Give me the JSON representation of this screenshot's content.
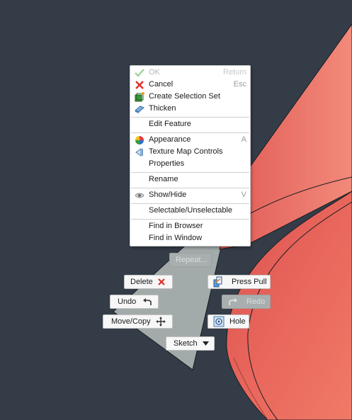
{
  "context_menu": {
    "items": [
      {
        "label": "OK",
        "shortcut": "Return",
        "icon": "checkmark-icon",
        "disabled": true
      },
      {
        "label": "Cancel",
        "shortcut": "Esc",
        "icon": "red-x-icon"
      },
      {
        "label": "Create Selection Set",
        "shortcut": "",
        "icon": "selection-set-icon"
      },
      {
        "label": "Thicken",
        "shortcut": "",
        "icon": "thicken-icon"
      },
      {
        "label": "Edit Feature",
        "shortcut": ""
      },
      {
        "label": "Appearance",
        "shortcut": "A",
        "icon": "appearance-icon"
      },
      {
        "label": "Texture Map Controls",
        "shortcut": "",
        "icon": "texture-map-icon"
      },
      {
        "label": "Properties",
        "shortcut": ""
      },
      {
        "label": "Rename",
        "shortcut": ""
      },
      {
        "label": "Show/Hide",
        "shortcut": "V",
        "icon": "eye-icon"
      },
      {
        "label": "Selectable/Unselectable",
        "shortcut": ""
      },
      {
        "label": "Find in Browser",
        "shortcut": ""
      },
      {
        "label": "Find in Window",
        "shortcut": ""
      }
    ]
  },
  "marking_menu": {
    "repeat": "Repeat...",
    "delete": "Delete",
    "press_pull": "Press Pull",
    "undo": "Undo",
    "redo": "Redo",
    "move_copy": "Move/Copy",
    "hole": "Hole",
    "sketch": "Sketch"
  },
  "colors": {
    "canvas_background": "#343c47",
    "selected_body": "#a3abaa",
    "red_body": "#e8625a",
    "menu_background": "#ffffff"
  }
}
